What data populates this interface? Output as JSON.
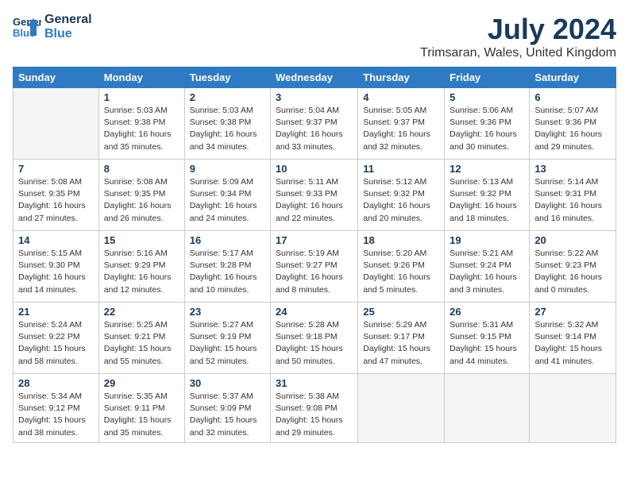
{
  "header": {
    "logo_line1": "General",
    "logo_line2": "Blue",
    "month_year": "July 2024",
    "location": "Trimsaran, Wales, United Kingdom"
  },
  "days": [
    "Sunday",
    "Monday",
    "Tuesday",
    "Wednesday",
    "Thursday",
    "Friday",
    "Saturday"
  ],
  "weeks": [
    [
      {
        "date": "",
        "empty": true
      },
      {
        "date": "1",
        "rise": "5:03 AM",
        "set": "9:38 PM",
        "daylight": "16 hours and 35 minutes."
      },
      {
        "date": "2",
        "rise": "5:03 AM",
        "set": "9:38 PM",
        "daylight": "16 hours and 34 minutes."
      },
      {
        "date": "3",
        "rise": "5:04 AM",
        "set": "9:37 PM",
        "daylight": "16 hours and 33 minutes."
      },
      {
        "date": "4",
        "rise": "5:05 AM",
        "set": "9:37 PM",
        "daylight": "16 hours and 32 minutes."
      },
      {
        "date": "5",
        "rise": "5:06 AM",
        "set": "9:36 PM",
        "daylight": "16 hours and 30 minutes."
      },
      {
        "date": "6",
        "rise": "5:07 AM",
        "set": "9:36 PM",
        "daylight": "16 hours and 29 minutes."
      }
    ],
    [
      {
        "date": "7",
        "rise": "5:08 AM",
        "set": "9:35 PM",
        "daylight": "16 hours and 27 minutes."
      },
      {
        "date": "8",
        "rise": "5:08 AM",
        "set": "9:35 PM",
        "daylight": "16 hours and 26 minutes."
      },
      {
        "date": "9",
        "rise": "5:09 AM",
        "set": "9:34 PM",
        "daylight": "16 hours and 24 minutes."
      },
      {
        "date": "10",
        "rise": "5:11 AM",
        "set": "9:33 PM",
        "daylight": "16 hours and 22 minutes."
      },
      {
        "date": "11",
        "rise": "5:12 AM",
        "set": "9:32 PM",
        "daylight": "16 hours and 20 minutes."
      },
      {
        "date": "12",
        "rise": "5:13 AM",
        "set": "9:32 PM",
        "daylight": "16 hours and 18 minutes."
      },
      {
        "date": "13",
        "rise": "5:14 AM",
        "set": "9:31 PM",
        "daylight": "16 hours and 16 minutes."
      }
    ],
    [
      {
        "date": "14",
        "rise": "5:15 AM",
        "set": "9:30 PM",
        "daylight": "16 hours and 14 minutes."
      },
      {
        "date": "15",
        "rise": "5:16 AM",
        "set": "9:29 PM",
        "daylight": "16 hours and 12 minutes."
      },
      {
        "date": "16",
        "rise": "5:17 AM",
        "set": "9:28 PM",
        "daylight": "16 hours and 10 minutes."
      },
      {
        "date": "17",
        "rise": "5:19 AM",
        "set": "9:27 PM",
        "daylight": "16 hours and 8 minutes."
      },
      {
        "date": "18",
        "rise": "5:20 AM",
        "set": "9:26 PM",
        "daylight": "16 hours and 5 minutes."
      },
      {
        "date": "19",
        "rise": "5:21 AM",
        "set": "9:24 PM",
        "daylight": "16 hours and 3 minutes."
      },
      {
        "date": "20",
        "rise": "5:22 AM",
        "set": "9:23 PM",
        "daylight": "16 hours and 0 minutes."
      }
    ],
    [
      {
        "date": "21",
        "rise": "5:24 AM",
        "set": "9:22 PM",
        "daylight": "15 hours and 58 minutes."
      },
      {
        "date": "22",
        "rise": "5:25 AM",
        "set": "9:21 PM",
        "daylight": "15 hours and 55 minutes."
      },
      {
        "date": "23",
        "rise": "5:27 AM",
        "set": "9:19 PM",
        "daylight": "15 hours and 52 minutes."
      },
      {
        "date": "24",
        "rise": "5:28 AM",
        "set": "9:18 PM",
        "daylight": "15 hours and 50 minutes."
      },
      {
        "date": "25",
        "rise": "5:29 AM",
        "set": "9:17 PM",
        "daylight": "15 hours and 47 minutes."
      },
      {
        "date": "26",
        "rise": "5:31 AM",
        "set": "9:15 PM",
        "daylight": "15 hours and 44 minutes."
      },
      {
        "date": "27",
        "rise": "5:32 AM",
        "set": "9:14 PM",
        "daylight": "15 hours and 41 minutes."
      }
    ],
    [
      {
        "date": "28",
        "rise": "5:34 AM",
        "set": "9:12 PM",
        "daylight": "15 hours and 38 minutes."
      },
      {
        "date": "29",
        "rise": "5:35 AM",
        "set": "9:11 PM",
        "daylight": "15 hours and 35 minutes."
      },
      {
        "date": "30",
        "rise": "5:37 AM",
        "set": "9:09 PM",
        "daylight": "15 hours and 32 minutes."
      },
      {
        "date": "31",
        "rise": "5:38 AM",
        "set": "9:08 PM",
        "daylight": "15 hours and 29 minutes."
      },
      {
        "date": "",
        "empty": true
      },
      {
        "date": "",
        "empty": true
      },
      {
        "date": "",
        "empty": true
      }
    ]
  ],
  "labels": {
    "sunrise": "Sunrise:",
    "sunset": "Sunset:",
    "daylight": "Daylight:"
  }
}
